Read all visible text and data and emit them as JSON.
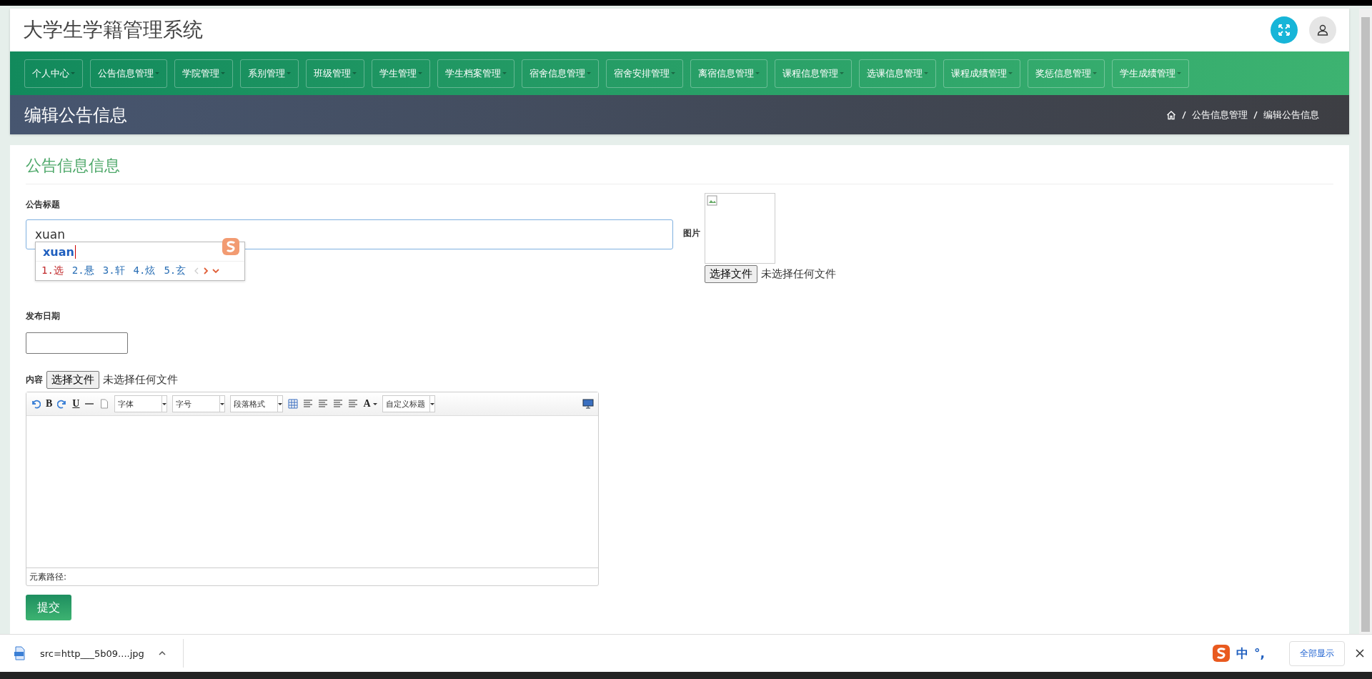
{
  "header": {
    "title": "大学生学籍管理系统"
  },
  "nav": [
    {
      "label": "个人中心"
    },
    {
      "label": "公告信息管理"
    },
    {
      "label": "学院管理"
    },
    {
      "label": "系别管理"
    },
    {
      "label": "班级管理"
    },
    {
      "label": "学生管理"
    },
    {
      "label": "学生档案管理"
    },
    {
      "label": "宿舍信息管理"
    },
    {
      "label": "宿舍安排管理"
    },
    {
      "label": "离宿信息管理"
    },
    {
      "label": "课程信息管理"
    },
    {
      "label": "选课信息管理"
    },
    {
      "label": "课程成绩管理"
    },
    {
      "label": "奖惩信息管理"
    },
    {
      "label": "学生成绩管理"
    }
  ],
  "page_title": "编辑公告信息",
  "breadcrumb": [
    "公告信息管理",
    "编辑公告信息"
  ],
  "form": {
    "heading": "公告信息信息",
    "title_label": "公告标题",
    "title_value": "xuan",
    "ime": {
      "pinyin": "xuan",
      "candidates": [
        {
          "label": "1.选",
          "selected": true
        },
        {
          "label": "2.悬",
          "selected": false
        },
        {
          "label": "3.轩",
          "selected": false
        },
        {
          "label": "4.炫",
          "selected": false
        },
        {
          "label": "5.玄",
          "selected": false
        }
      ]
    },
    "image_label": "图片",
    "image_file_button": "选择文件",
    "image_file_status": "未选择任何文件",
    "date_label": "发布日期",
    "content_label": "内容",
    "content_file_button": "选择文件",
    "content_file_status": "未选择任何文件",
    "toolbar": [
      {
        "kind": "undo"
      },
      {
        "kind": "letter",
        "label": "B"
      },
      {
        "kind": "redo"
      },
      {
        "kind": "letter",
        "label": "U"
      },
      {
        "kind": "rule"
      },
      {
        "kind": "page"
      },
      {
        "kind": "select",
        "label": "字体"
      },
      {
        "kind": "select",
        "label": "字号"
      },
      {
        "kind": "select",
        "label": "段落格式"
      },
      {
        "kind": "table"
      },
      {
        "kind": "align"
      },
      {
        "kind": "align"
      },
      {
        "kind": "align"
      },
      {
        "kind": "align"
      },
      {
        "kind": "color",
        "label": "A"
      },
      {
        "kind": "select",
        "label": "自定义标题"
      },
      {
        "kind": "preview"
      }
    ],
    "element_path": "元素路径:",
    "submit": "提交"
  },
  "download_bar": {
    "file": "src=http___5b09....jpg",
    "show_all": "全部显示"
  },
  "ime_status": {
    "mode": "中",
    "punct": "°,"
  }
}
